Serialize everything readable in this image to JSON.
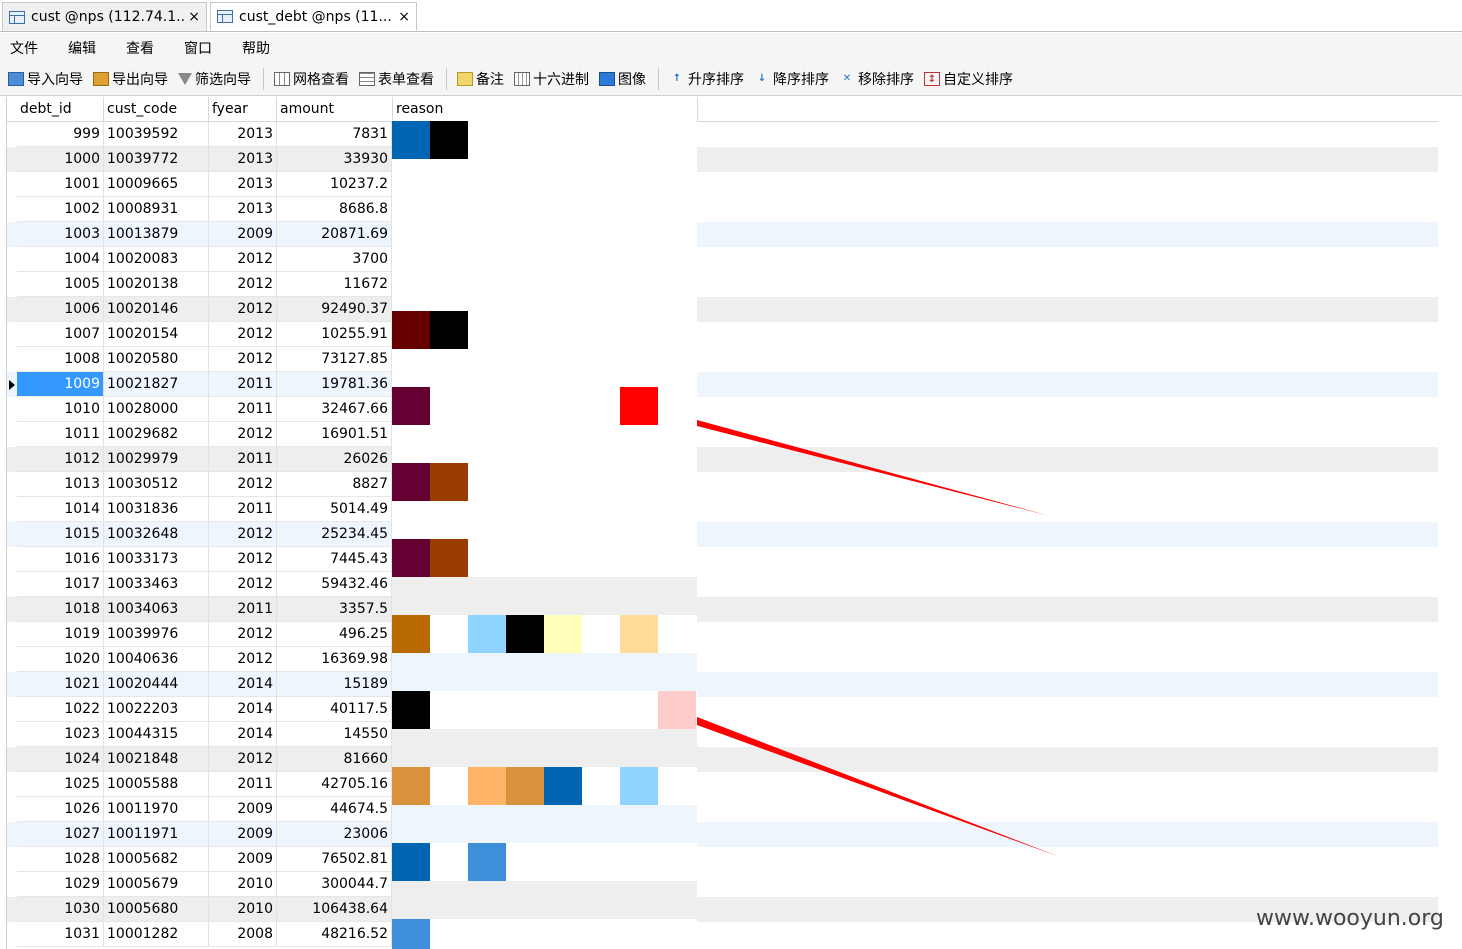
{
  "tabs": [
    {
      "label": "cust @nps (112.74.1...",
      "close": "×"
    },
    {
      "label": "cust_debt @nps (11...",
      "close": "×"
    }
  ],
  "menu": [
    "文件",
    "编辑",
    "查看",
    "窗口",
    "帮助"
  ],
  "toolbar": [
    {
      "icon": "import-wizard-icon",
      "label": "导入向导"
    },
    {
      "icon": "export-wizard-icon",
      "label": "导出向导"
    },
    {
      "icon": "filter-icon",
      "label": "筛选向导"
    },
    {
      "icon": "grid-view-icon",
      "label": "网格查看"
    },
    {
      "icon": "form-view-icon",
      "label": "表单查看"
    },
    {
      "icon": "note-icon",
      "label": "备注"
    },
    {
      "icon": "hex-icon",
      "label": "十六进制"
    },
    {
      "icon": "image-icon",
      "label": "图像"
    },
    {
      "icon": "sort-asc-icon",
      "label": "升序排序"
    },
    {
      "icon": "sort-desc-icon",
      "label": "降序排序"
    },
    {
      "icon": "remove-sort-icon",
      "label": "移除排序"
    },
    {
      "icon": "custom-sort-icon",
      "label": "自定义排序"
    }
  ],
  "columns": [
    "debt_id",
    "cust_code",
    "fyear",
    "amount",
    "reason"
  ],
  "rows": [
    [
      "999",
      "10039592",
      "2013",
      "7831"
    ],
    [
      "1000",
      "10039772",
      "2013",
      "33930"
    ],
    [
      "1001",
      "10009665",
      "2013",
      "10237.2"
    ],
    [
      "1002",
      "10008931",
      "2013",
      "8686.8"
    ],
    [
      "1003",
      "10013879",
      "2009",
      "20871.69"
    ],
    [
      "1004",
      "10020083",
      "2012",
      "3700"
    ],
    [
      "1005",
      "10020138",
      "2012",
      "11672"
    ],
    [
      "1006",
      "10020146",
      "2012",
      "92490.37"
    ],
    [
      "1007",
      "10020154",
      "2012",
      "10255.91"
    ],
    [
      "1008",
      "10020580",
      "2012",
      "73127.85"
    ],
    [
      "1009",
      "10021827",
      "2011",
      "19781.36"
    ],
    [
      "1010",
      "10028000",
      "2011",
      "32467.66"
    ],
    [
      "1011",
      "10029682",
      "2012",
      "16901.51"
    ],
    [
      "1012",
      "10029979",
      "2011",
      "26026"
    ],
    [
      "1013",
      "10030512",
      "2012",
      "8827"
    ],
    [
      "1014",
      "10031836",
      "2011",
      "5014.49"
    ],
    [
      "1015",
      "10032648",
      "2012",
      "25234.45"
    ],
    [
      "1016",
      "10033173",
      "2012",
      "7445.43"
    ],
    [
      "1017",
      "10033463",
      "2012",
      "59432.46"
    ],
    [
      "1018",
      "10034063",
      "2011",
      "3357.5"
    ],
    [
      "1019",
      "10039976",
      "2012",
      "496.25"
    ],
    [
      "1020",
      "10040636",
      "2012",
      "16369.98"
    ],
    [
      "1021",
      "10020444",
      "2014",
      "15189"
    ],
    [
      "1022",
      "10022203",
      "2014",
      "40117.5"
    ],
    [
      "1023",
      "10044315",
      "2014",
      "14550"
    ],
    [
      "1024",
      "10021848",
      "2012",
      "81660"
    ],
    [
      "1025",
      "10005588",
      "2011",
      "42705.16"
    ],
    [
      "1026",
      "10011970",
      "2009",
      "44674.5"
    ],
    [
      "1027",
      "10011971",
      "2009",
      "23006"
    ],
    [
      "1028",
      "10005682",
      "2009",
      "76502.81"
    ],
    [
      "1029",
      "10005679",
      "2010",
      "300044.7"
    ],
    [
      "1030",
      "10005680",
      "2010",
      "106438.64"
    ],
    [
      "1031",
      "10001282",
      "2008",
      "48216.52"
    ]
  ],
  "row_styles": [
    "",
    "alt",
    "",
    "",
    "blue",
    "",
    "",
    "alt",
    "",
    "",
    "blue",
    "",
    "",
    "alt",
    "",
    "",
    "blue",
    "",
    "",
    "alt",
    "",
    "",
    "blue",
    "",
    "",
    "alt",
    "",
    "",
    "blue",
    "",
    "",
    "alt",
    ""
  ],
  "selected_row": 10,
  "reason_colors": {
    "blue": "#0066b3",
    "black": "#000000",
    "maroon": "#660000",
    "purple": "#660033",
    "brown": "#993d00",
    "red": "#ff0000",
    "orange": "#b86a00",
    "lightblue": "#8fd4ff",
    "cream": "#ffffbb",
    "peach": "#ffdd99",
    "pink": "#ffcccc",
    "tan": "#d9913c",
    "lightorange": "#ffb366",
    "midblue": "#3d8fd9"
  },
  "annotation_color": "#ff0000",
  "watermark": "www.wooyun.org"
}
